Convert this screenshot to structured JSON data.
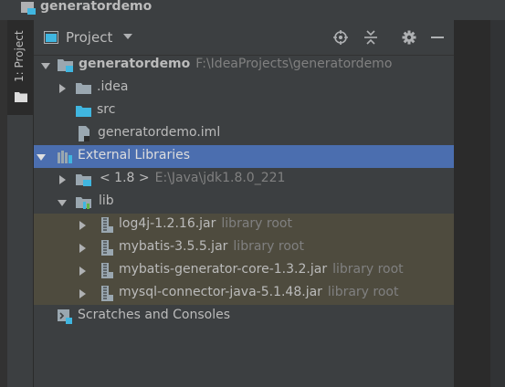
{
  "window": {
    "title": "generatordemo"
  },
  "tool_window_stripe": {
    "label": "1: Project"
  },
  "panel": {
    "view_label": "Project"
  },
  "tree": [
    {
      "label": "generatordemo",
      "path": "F:\\IdeaProjects\\generatordemo"
    },
    {
      "label": ".idea"
    },
    {
      "label": "src"
    },
    {
      "label": "generatordemo.iml"
    },
    {
      "label": "External Libraries"
    },
    {
      "label": "< 1.8 >",
      "path": "E:\\Java\\jdk1.8.0_221"
    },
    {
      "label": "lib"
    },
    {
      "label": "log4j-1.2.16.jar",
      "note": "library root"
    },
    {
      "label": "mybatis-3.5.5.jar",
      "note": "library root"
    },
    {
      "label": "mybatis-generator-core-1.3.2.jar",
      "note": "library root"
    },
    {
      "label": "mysql-connector-java-5.1.48.jar",
      "note": "library root"
    },
    {
      "label": "Scratches and Consoles"
    }
  ],
  "icons": [
    "project-icon",
    "folder-icon",
    "view-icon",
    "chevron-down-icon",
    "locate-icon",
    "collapse-all-icon",
    "gear-icon",
    "hide-icon",
    "module-folder-icon",
    "source-folder-icon",
    "iml-file-icon",
    "libraries-icon",
    "jdk-icon",
    "jar-icon",
    "scratches-icon"
  ],
  "colors": {
    "selection": "#4b6eaf",
    "library_root_row": "#4e4b3e",
    "panel_bg": "#3c3f41",
    "editor_bg": "#2b2b2b",
    "text": "#bbbbbb",
    "dim_text": "#808080"
  }
}
